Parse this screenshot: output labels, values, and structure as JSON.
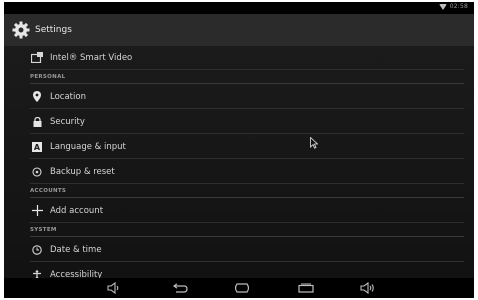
{
  "statusbar": {
    "clock": "02:58"
  },
  "actionbar": {
    "title": "Settings"
  },
  "items": {
    "smart_video": "Intel® Smart Video",
    "location": "Location",
    "security": "Security",
    "language": "Language & input",
    "backup": "Backup & reset",
    "add_account": "Add account",
    "date_time": "Date & time",
    "accessibility": "Accessibility"
  },
  "headers": {
    "personal": "PERSONAL",
    "accounts": "ACCOUNTS",
    "system": "SYSTEM"
  },
  "icons": {
    "settings": "gear-icon",
    "smart_video": "smart-video-icon",
    "location": "location-pin-icon",
    "security": "lock-icon",
    "language": "keyboard-icon",
    "backup": "backup-restore-icon",
    "add_account": "plus-icon",
    "date_time": "clock-icon",
    "accessibility": "accessibility-icon",
    "wifi": "wifi-icon",
    "nav": [
      "volume-down-icon",
      "back-icon",
      "home-icon",
      "recent-apps-icon",
      "volume-up-icon"
    ]
  },
  "colors": {
    "background": "#151515",
    "actionbar": "#2b2b2b",
    "text": "#d6d6d6",
    "header_text": "#9a9a9a"
  }
}
